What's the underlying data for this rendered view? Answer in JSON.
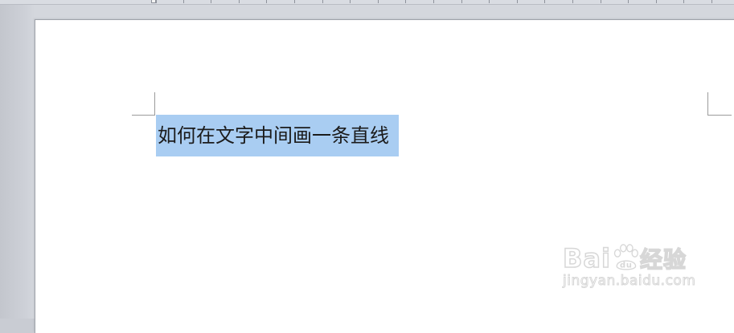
{
  "document": {
    "selected_text": "如何在文字中间画一条直线"
  },
  "watermark": {
    "logo_prefix": "Bai",
    "logo_suffix": "经验",
    "sub_text": "jingyan.baidu.com",
    "paw_letters": "du"
  },
  "colors": {
    "selection_highlight": "#a9cdf2",
    "page_background": "#ffffff",
    "workspace_background": "#c9ccd3"
  }
}
